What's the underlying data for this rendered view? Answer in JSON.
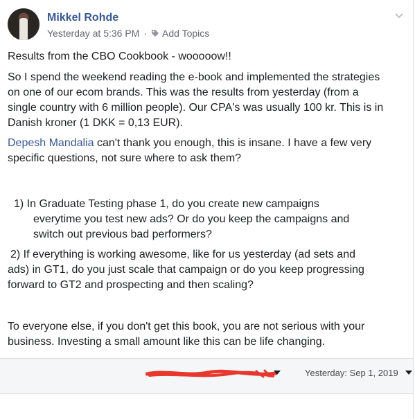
{
  "post": {
    "author": "Mikkel Rohde",
    "time": "Yesterday at 5:36 PM",
    "separator": "·",
    "add_topics": "Add Topics",
    "paragraphs": {
      "p1": "Results from the CBO Cookbook - wooooow!!",
      "p2a": "So I spend the weekend reading the e-book and implemented the strategies",
      "p2b": "on one of our ecom brands. This was the results from yesterday (from a",
      "p2c": "single country with 6 million people). Our CPA's was usually 100 kr. This is in",
      "p2d": "Danish kroner (1 DKK = 0,13 EUR).",
      "mention": "Depesh Mandalia",
      "p3a_rest": " can't thank you enough, this is insane. I have a few very",
      "p3b": "specific questions, not sure where to ask them?",
      "q1a": "1)   In Graduate Testing phase 1, do you create new campaigns",
      "q1b": "everytime you test new ads? Or do you keep the campaigns and",
      "q1c": "switch out previous bad performers?",
      "q2a": "2)  If everything is working awesome, like for us yesterday (ad sets and",
      "q2b": "ads) in GT1, do you just scale that campaign or do you keep progressing",
      "q2c": "forward to GT2 and prospecting and then scaling?",
      "p4a": "To everyone else, if you don't get this book, you are not serious with your",
      "p4b": "business. Investing a small amount like this can be life changing."
    }
  },
  "footer": {
    "date": "Yesterday: Sep 1, 2019"
  },
  "colors": {
    "link": "#385898",
    "meta": "#606770",
    "redaction": "#e8372c",
    "footer_bg": "#f5f6f7"
  },
  "icons": [
    "chevron-down-icon",
    "tag-icon",
    "caret-down-icon"
  ]
}
